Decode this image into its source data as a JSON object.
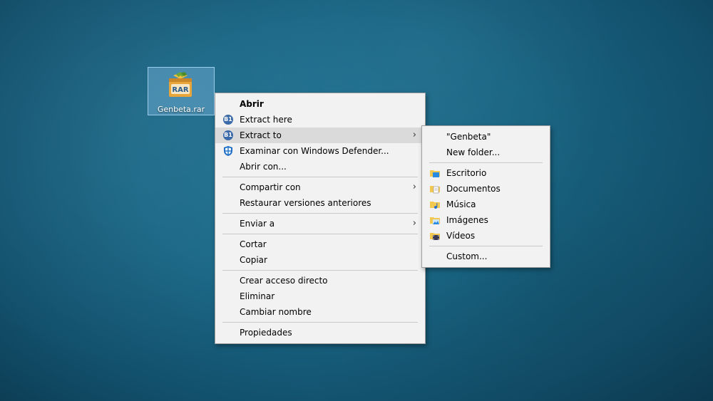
{
  "file": {
    "name": "Genbeta.rar",
    "icon": "rar-archive-icon"
  },
  "context_menu": {
    "items": [
      {
        "label": "Abrir"
      },
      {
        "label": "Extract here",
        "icon_text": "B1"
      },
      {
        "label": "Extract to",
        "icon_text": "B1"
      },
      {
        "label": "Examinar con Windows Defender..."
      },
      {
        "label": "Abrir con..."
      },
      {
        "label": "Compartir con"
      },
      {
        "label": "Restaurar versiones anteriores"
      },
      {
        "label": "Enviar a"
      },
      {
        "label": "Cortar"
      },
      {
        "label": "Copiar"
      },
      {
        "label": "Crear acceso directo"
      },
      {
        "label": "Eliminar"
      },
      {
        "label": "Cambiar nombre"
      },
      {
        "label": "Propiedades"
      }
    ]
  },
  "submenu": {
    "items": [
      {
        "label": "\"Genbeta\""
      },
      {
        "label": "New folder..."
      },
      {
        "label": "Escritorio",
        "icon": "desktop-folder-icon"
      },
      {
        "label": "Documentos",
        "icon": "documents-folder-icon"
      },
      {
        "label": "Música",
        "icon": "music-folder-icon"
      },
      {
        "label": "Imágenes",
        "icon": "pictures-folder-icon"
      },
      {
        "label": "Vídeos",
        "icon": "videos-folder-icon"
      },
      {
        "label": "Custom..."
      }
    ]
  },
  "colors": {
    "desktop": "#196786",
    "menu_bg": "#f2f2f2",
    "hover": "#dadada",
    "b1_badge": "#3a6aa8"
  }
}
